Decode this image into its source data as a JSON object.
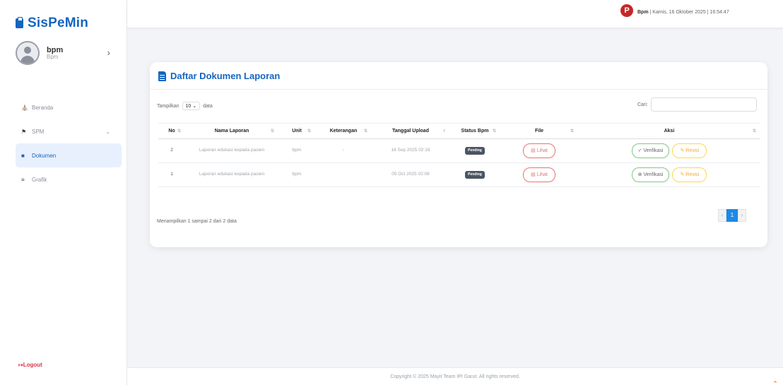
{
  "brand": {
    "name": "SisPeMin"
  },
  "profile": {
    "name": "bpm",
    "role": "Bpm"
  },
  "nav": [
    {
      "label": "Beranda",
      "icon": "home-icon"
    },
    {
      "label": "SPM",
      "icon": "flag-icon"
    },
    {
      "label": "Dokumen",
      "icon": "folder-icon"
    },
    {
      "label": "Grafik",
      "icon": "chart-icon"
    }
  ],
  "logout": "Logout",
  "topbar": {
    "user": "Bpm",
    "datetime": "| Kamis, 16 Oktober 2025 | 16:54:47"
  },
  "card": {
    "title": "Daftar Dokumen Laporan",
    "show_label": "Tampilkan",
    "show_value": "10",
    "show_suffix": "data",
    "search_label": "Cari:",
    "columns": [
      "No",
      "Nama Laporan",
      "Unit",
      "Keterangan",
      "Tanggal Upload",
      "Status Bpm",
      "File",
      "Aksi"
    ],
    "rows": [
      {
        "no": "2",
        "nama": "Laporan edukasi kepada pasien",
        "unit": "bpm",
        "ket": "-",
        "tgl": "16 Sep 2025 02:16",
        "status": "Pending",
        "file": "Lihat",
        "verif": "Verifikasi",
        "revisi": "Revisi"
      },
      {
        "no": "1",
        "nama": "Laporan edukasi kepada pasien",
        "unit": "bpm",
        "ket": "",
        "tgl": "05 Oct 2025 02:08",
        "status": "Pending",
        "file": "Lihat",
        "verif": "Verifikasi",
        "revisi": "Revisi"
      }
    ],
    "info": "Menampilkan 1 sampai 2 dari 2 data",
    "pager": {
      "prev": "‹",
      "current": "1",
      "next": "›"
    }
  },
  "footer": "Copyright © 2025 Mayit Team IPI Garut. All rights reserved."
}
